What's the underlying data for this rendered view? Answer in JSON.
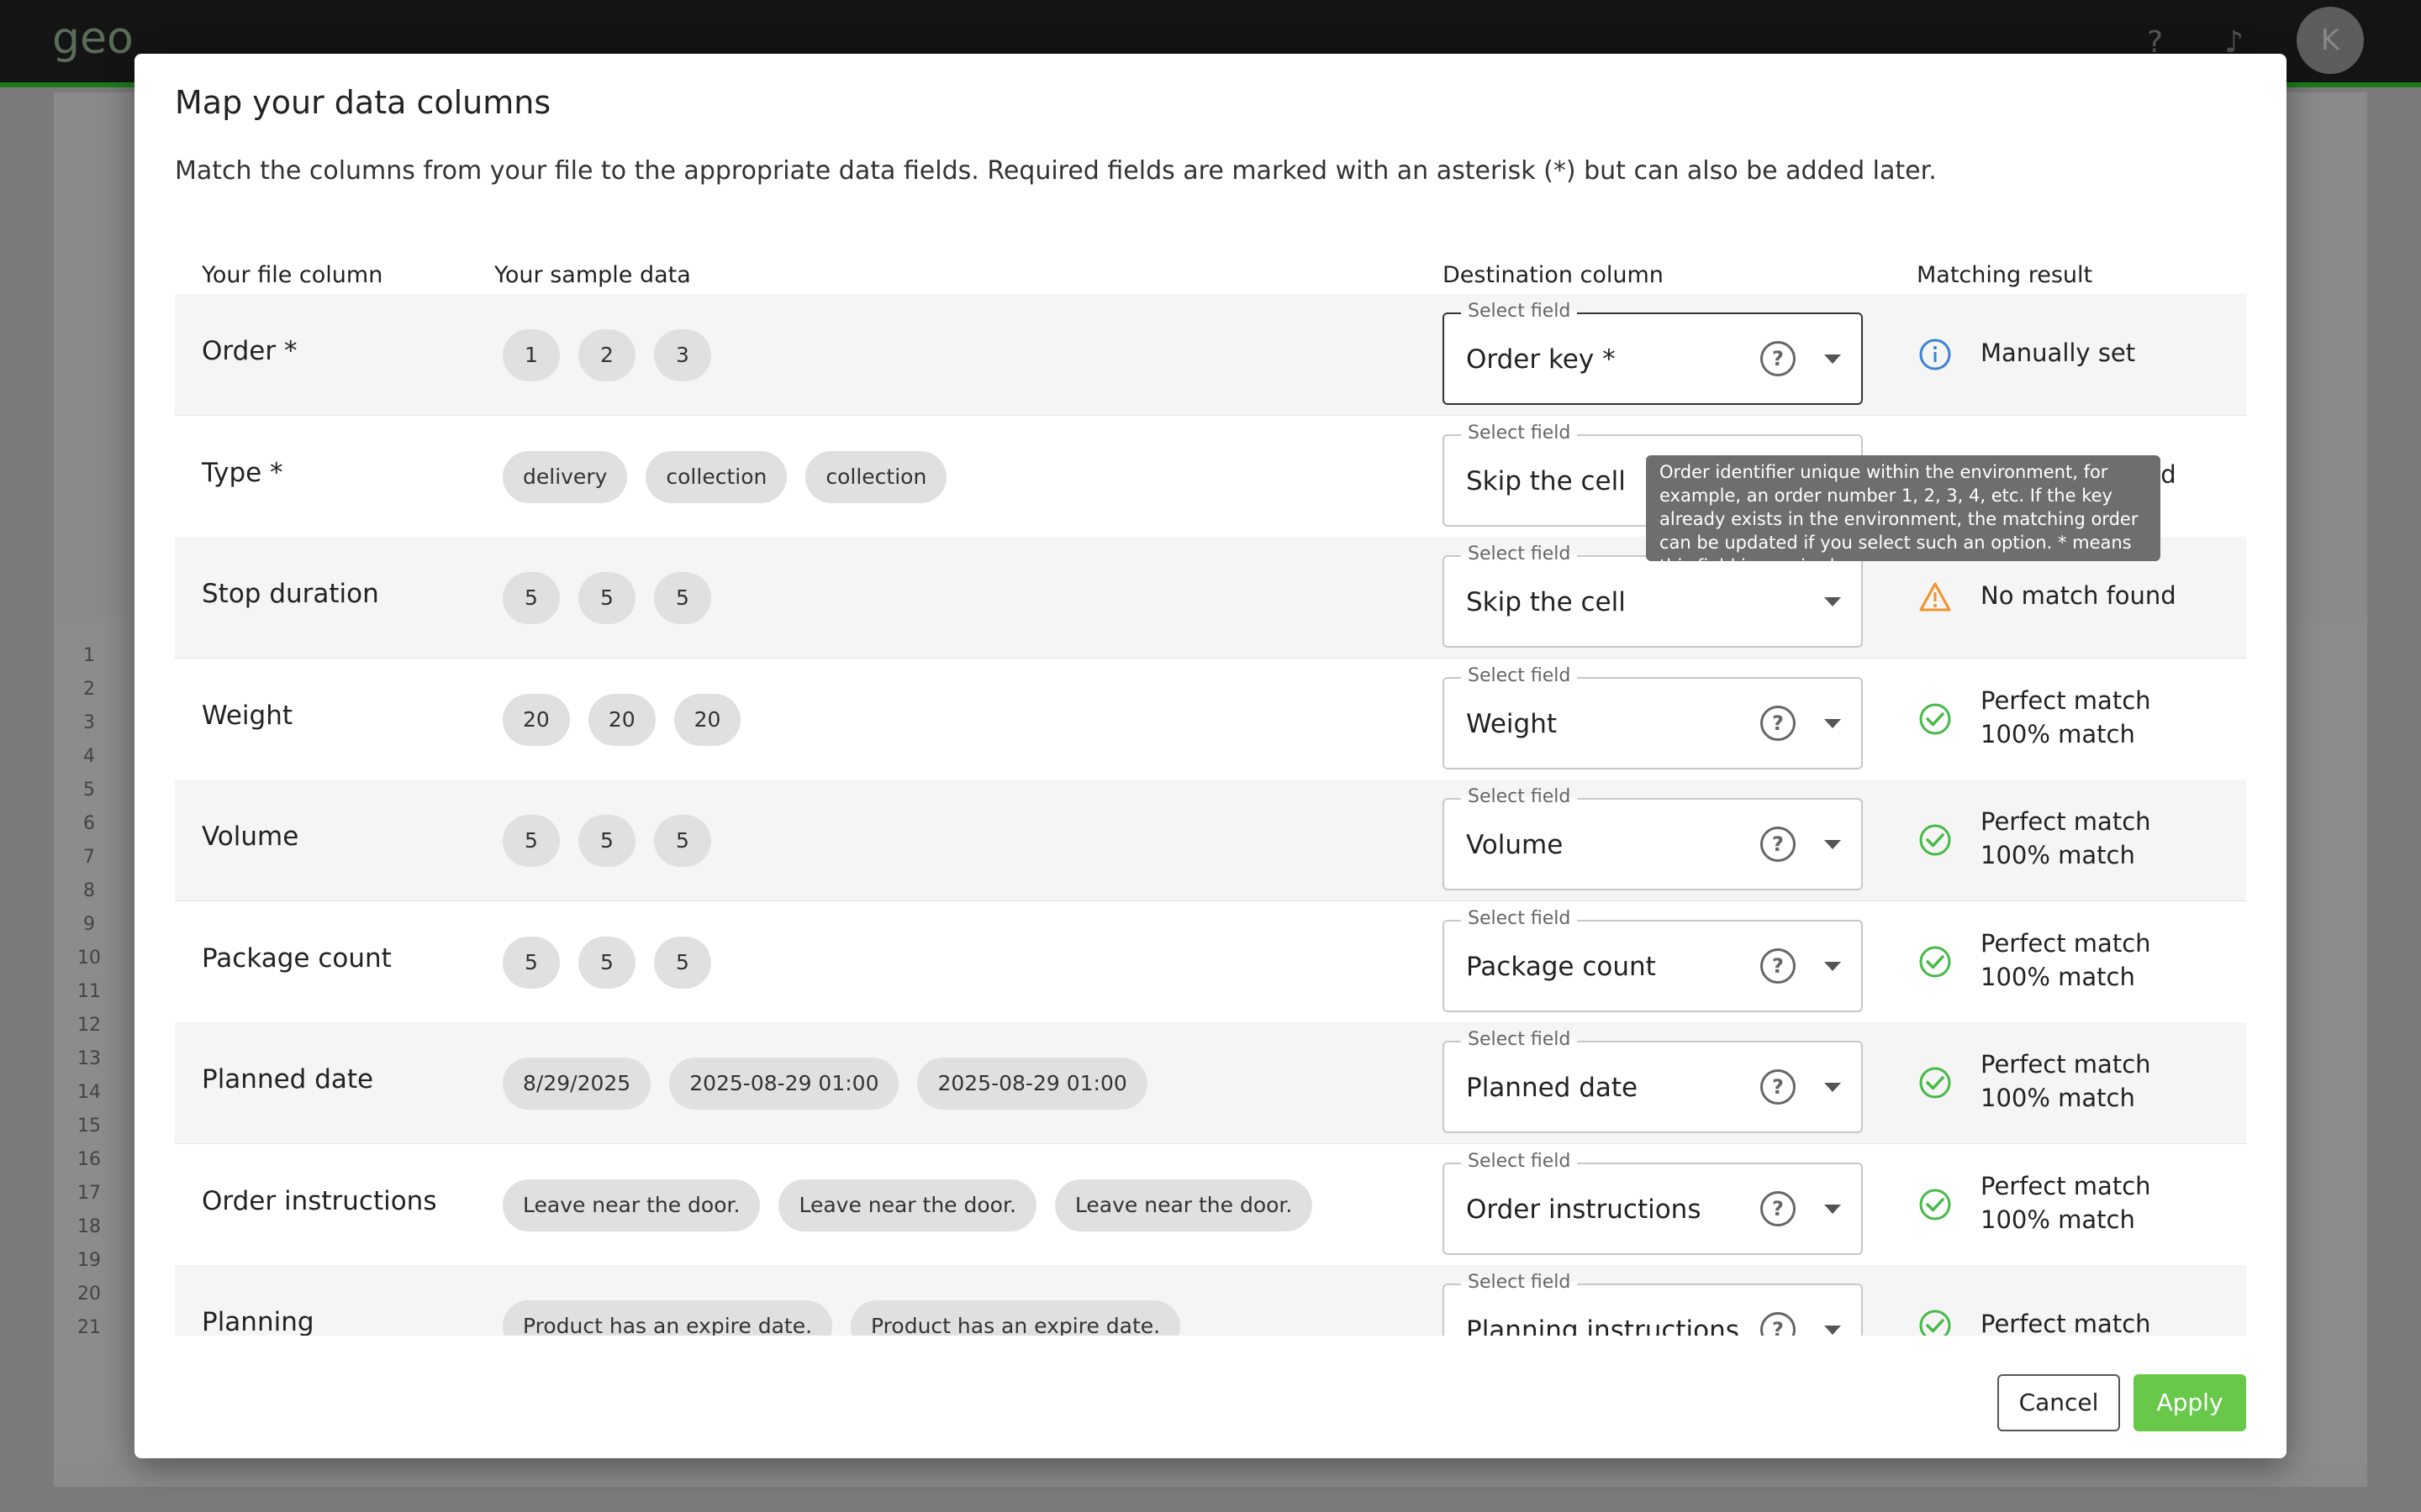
{
  "background": {
    "logo_text": "geo",
    "avatar_letter": "K",
    "row_numbers": [
      "1",
      "2",
      "3",
      "4",
      "5",
      "6",
      "7",
      "8",
      "9",
      "10",
      "11",
      "12",
      "13",
      "14",
      "15",
      "16",
      "17",
      "18",
      "19",
      "20",
      "21"
    ]
  },
  "modal": {
    "title": "Map your data columns",
    "subtitle": "Match the columns from your file to the appropriate data fields. Required fields are marked with an asterisk (*) but can also be added later.",
    "headers": {
      "file_column": "Your file column",
      "sample_data": "Your sample data",
      "destination": "Destination column",
      "result": "Matching result"
    },
    "select_label": "Select field",
    "rows": [
      {
        "name": "Order *",
        "samples": [
          "1",
          "2",
          "3"
        ],
        "destination": "Order key *",
        "help": true,
        "status": "info",
        "result_1": "Manually set",
        "result_2": ""
      },
      {
        "name": "Type *",
        "samples": [
          "delivery",
          "collection",
          "collection"
        ],
        "destination": "Skip the cell",
        "help": false,
        "status": "warning",
        "result_1": "No match found",
        "result_2": ""
      },
      {
        "name": "Stop duration",
        "samples": [
          "5",
          "5",
          "5"
        ],
        "destination": "Skip the cell",
        "help": false,
        "status": "warning",
        "result_1": "No match found",
        "result_2": ""
      },
      {
        "name": "Weight",
        "samples": [
          "20",
          "20",
          "20"
        ],
        "destination": "Weight",
        "help": true,
        "status": "success",
        "result_1": "Perfect match",
        "result_2": "100% match"
      },
      {
        "name": "Volume",
        "samples": [
          "5",
          "5",
          "5"
        ],
        "destination": "Volume",
        "help": true,
        "status": "success",
        "result_1": "Perfect match",
        "result_2": "100% match"
      },
      {
        "name": "Package count",
        "samples": [
          "5",
          "5",
          "5"
        ],
        "destination": "Package count",
        "help": true,
        "status": "success",
        "result_1": "Perfect match",
        "result_2": "100% match"
      },
      {
        "name": "Planned date",
        "samples": [
          "8/29/2025",
          "2025-08-29 01:00",
          "2025-08-29 01:00"
        ],
        "destination": "Planned date",
        "help": true,
        "status": "success",
        "result_1": "Perfect match",
        "result_2": "100% match"
      },
      {
        "name": "Order instructions",
        "samples": [
          "Leave near the door.",
          "Leave near the door.",
          "Leave near the door."
        ],
        "destination": "Order instructions",
        "help": true,
        "status": "success",
        "result_1": "Perfect match",
        "result_2": "100% match"
      },
      {
        "name": "Planning",
        "samples": [
          "Product has an expire date.",
          "Product has an expire date."
        ],
        "destination": "Planning instructions",
        "help": true,
        "status": "success",
        "result_1": "Perfect match",
        "result_2": ""
      }
    ],
    "tooltip": "Order identifier unique within the environment, for example, an order number 1, 2, 3, 4, etc. If the key already exists in the environment, the matching order can be updated if you select such an option. * means this field is required.",
    "cancel_label": "Cancel",
    "apply_label": "Apply",
    "colors": {
      "info": "#3b82d6",
      "warning": "#f0932b",
      "success": "#46b946",
      "apply": "#68c84a"
    }
  }
}
